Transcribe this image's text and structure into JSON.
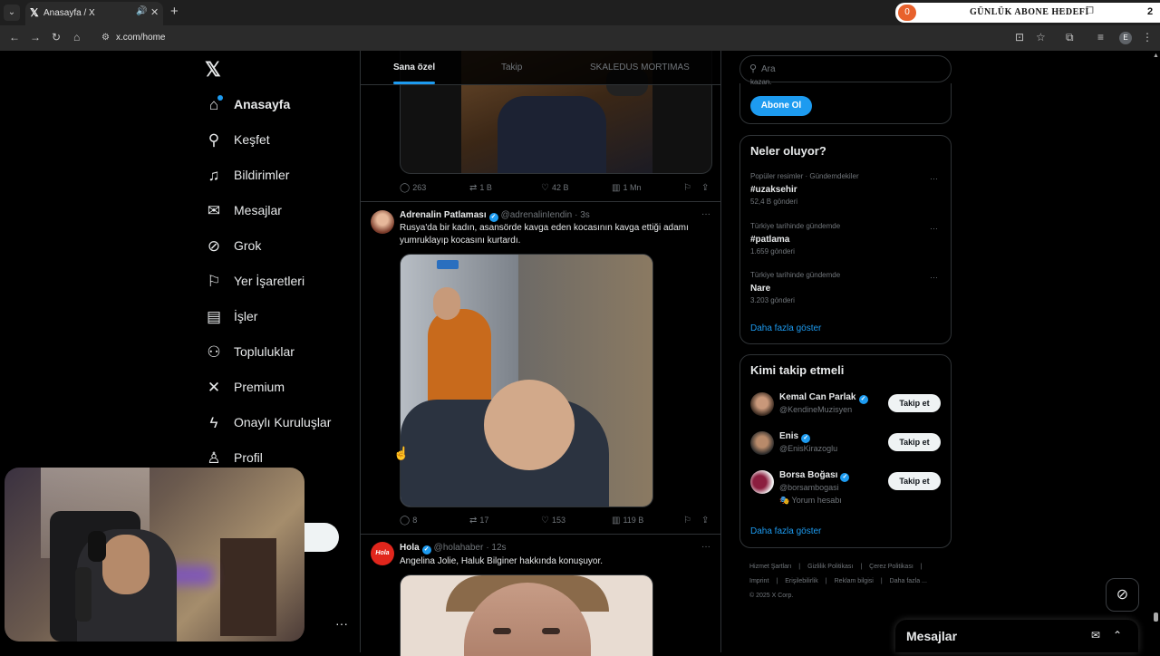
{
  "browser": {
    "tab_title": "Anasayfa / X",
    "url": "x.com/home",
    "overlay_badge": "0",
    "overlay_text": "GÜNLÜK ABONE HEDEFİ",
    "overlay_num": "2",
    "profile_initial": "E"
  },
  "nav": {
    "items": [
      {
        "label": "Anasayfa",
        "icon": "home-icon"
      },
      {
        "label": "Keşfet",
        "icon": "search-icon"
      },
      {
        "label": "Bildirimler",
        "icon": "bell-icon"
      },
      {
        "label": "Mesajlar",
        "icon": "mail-icon"
      },
      {
        "label": "Grok",
        "icon": "grok-icon"
      },
      {
        "label": "Yer İşaretleri",
        "icon": "bookmark-icon"
      },
      {
        "label": "İşler",
        "icon": "briefcase-icon"
      },
      {
        "label": "Topluluklar",
        "icon": "people-icon"
      },
      {
        "label": "Premium",
        "icon": "x-icon"
      },
      {
        "label": "Onaylı Kuruluşlar",
        "icon": "lightning-icon"
      },
      {
        "label": "Profil",
        "icon": "person-icon"
      }
    ],
    "more": "···"
  },
  "timeline": {
    "tabs": [
      "Sana özel",
      "Takip",
      "SKALEDUS MORTIMAS"
    ],
    "tweet0_actions": {
      "replies": "263",
      "reposts": "1 B",
      "likes": "42 B",
      "views": "1 Mn"
    },
    "tweet1": {
      "name": "Adrenalin Patlaması",
      "handle": "@adrenalinIendin",
      "time": "· 3s",
      "text": "Rusya'da bir kadın, asansörde kavga eden kocasının kavga ettiği adamı yumruklayıp kocasını kurtardı.",
      "replies": "8",
      "reposts": "17",
      "likes": "153",
      "views": "119 B"
    },
    "tweet2": {
      "name": "Hola",
      "handle": "@holahaber",
      "time": "· 12s",
      "text": "Angelina Jolie, Haluk Bilginer hakkında konuşuyor.",
      "logo": "Hola"
    }
  },
  "sidebar": {
    "search_placeholder": "Ara",
    "premium_cut": "Abone Ol",
    "premium_cut_top": "kazan.",
    "trends_title": "Neler oluyor?",
    "trends": [
      {
        "context": "Popüler resimler · Gündemdekiler",
        "name": "#uzaksehir",
        "count": "52,4 B gönderi"
      },
      {
        "context": "Türkiye tarihinde gündemde",
        "name": "#patlama",
        "count": "1.659 gönderi"
      },
      {
        "context": "Türkiye tarihinde gündemde",
        "name": "Nare",
        "count": "3.203 gönderi"
      }
    ],
    "trends_more": "Daha fazla göster",
    "wtf_title": "Kimi takip etmeli",
    "wtf": [
      {
        "name": "Kemal Can Parlak",
        "handle": "@KendineMuzisyen",
        "sub": "",
        "button": "Takip et"
      },
      {
        "name": "Enis",
        "handle": "@EnisKirazoglu",
        "sub": "",
        "button": "Takip et"
      },
      {
        "name": "Borsa Boğası",
        "handle": "@borsambogasi",
        "sub": "🎭 Yorum hesabı",
        "button": "Takip et"
      }
    ],
    "wtf_more": "Daha fazla göster",
    "footer": [
      "Hizmet Şartları",
      "|",
      "Gizlilik Politikası",
      "|",
      "Çerez Politikası",
      "|",
      "Imprint",
      "|",
      "Erişilebilirlik",
      "|",
      "Reklam bilgisi",
      "|",
      "Daha fazla ...",
      "© 2025 X Corp."
    ]
  },
  "messages_drawer": {
    "title": "Mesajlar"
  },
  "colors": {
    "accent": "#1d9bf0",
    "bg": "#000000",
    "border": "#2f3336",
    "muted": "#71767b"
  }
}
